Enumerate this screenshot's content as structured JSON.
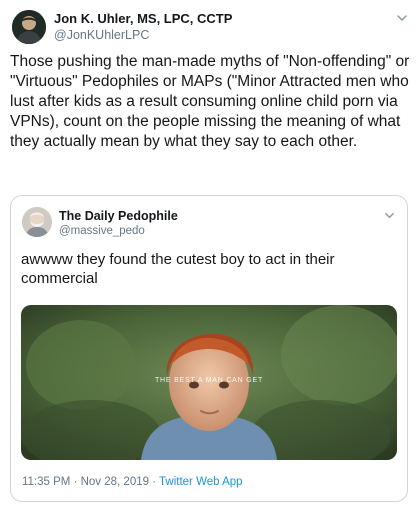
{
  "tweet": {
    "author": {
      "display_name": "Jon K. Uhler, MS, LPC, CCTP",
      "handle": "@JonKUhlerLPC",
      "avatar_icon": "profile-photo"
    },
    "text": "Those pushing the man-made myths of \"Non-offending\" or \"Virtuous\" Pedophiles or MAPs (\"Minor Attracted men who lust after kids as a result consuming online child porn via VPNs), count on the people missing the meaning of what they actually mean by what they say to each other.",
    "menu_icon": "chevron-down-icon"
  },
  "quoted_tweet": {
    "author": {
      "display_name": "The Daily Pedophile",
      "handle": "@massive_pedo",
      "avatar_icon": "profile-photo"
    },
    "text": "awwww they found the cutest boy to act in their commercial",
    "media": {
      "caption": "THE BEST A MAN CAN GET"
    },
    "timestamp": "11:35 PM · Nov 28, 2019",
    "separator": " · ",
    "source": "Twitter Web App",
    "menu_icon": "chevron-down-icon"
  },
  "colors": {
    "text": "#14171a",
    "secondary": "#657786",
    "link": "#1b95e0",
    "border": "#ccd6dd"
  }
}
